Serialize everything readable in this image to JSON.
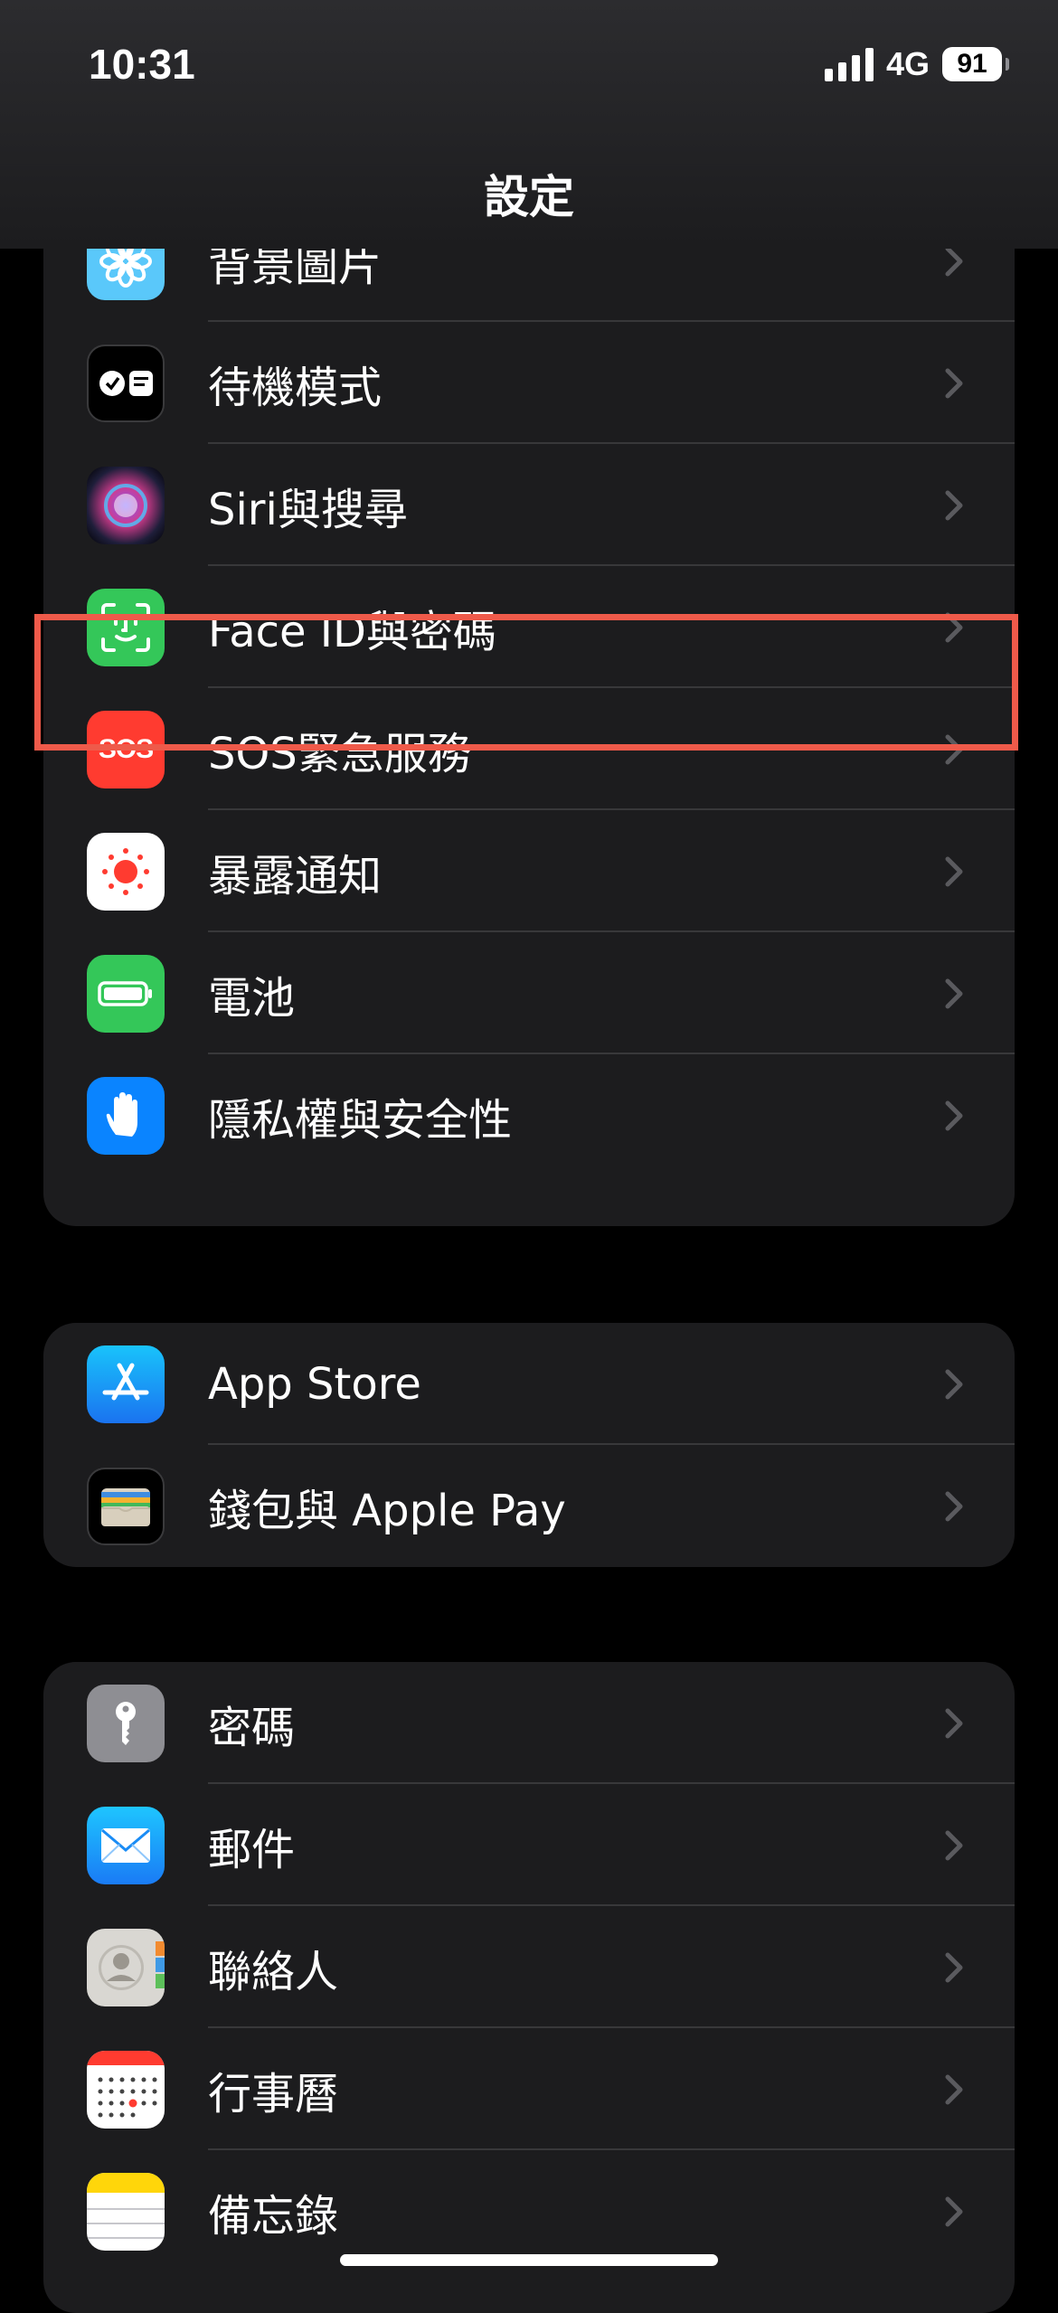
{
  "status": {
    "time": "10:31",
    "network": "4G",
    "battery": "91"
  },
  "nav": {
    "title": "設定"
  },
  "groups": [
    {
      "items": [
        {
          "label": "背景圖片",
          "icon": "wallpaper-icon"
        },
        {
          "label": "待機模式",
          "icon": "standby-icon"
        },
        {
          "label": "Siri與搜尋",
          "icon": "siri-icon"
        },
        {
          "label": "Face ID與密碼",
          "icon": "face-id-icon",
          "highlighted": true
        },
        {
          "label": "SOS緊急服務",
          "icon": "sos-icon"
        },
        {
          "label": "暴露通知",
          "icon": "exposure-notification-icon"
        },
        {
          "label": "電池",
          "icon": "battery-icon"
        },
        {
          "label": "隱私權與安全性",
          "icon": "privacy-hand-icon"
        }
      ]
    },
    {
      "items": [
        {
          "label": "App Store",
          "icon": "app-store-icon"
        },
        {
          "label": "錢包與 Apple Pay",
          "icon": "wallet-icon"
        }
      ]
    },
    {
      "items": [
        {
          "label": "密碼",
          "icon": "key-icon"
        },
        {
          "label": "郵件",
          "icon": "mail-icon"
        },
        {
          "label": "聯絡人",
          "icon": "contacts-icon"
        },
        {
          "label": "行事曆",
          "icon": "calendar-icon"
        },
        {
          "label": "備忘錄",
          "icon": "notes-icon"
        }
      ]
    }
  ],
  "sos_icon_text": "SOS",
  "colors": {
    "background": "#000000",
    "group_background": "#1c1c1e",
    "highlight_border": "#ef5a4a",
    "chevron": "#5a5a5e"
  }
}
